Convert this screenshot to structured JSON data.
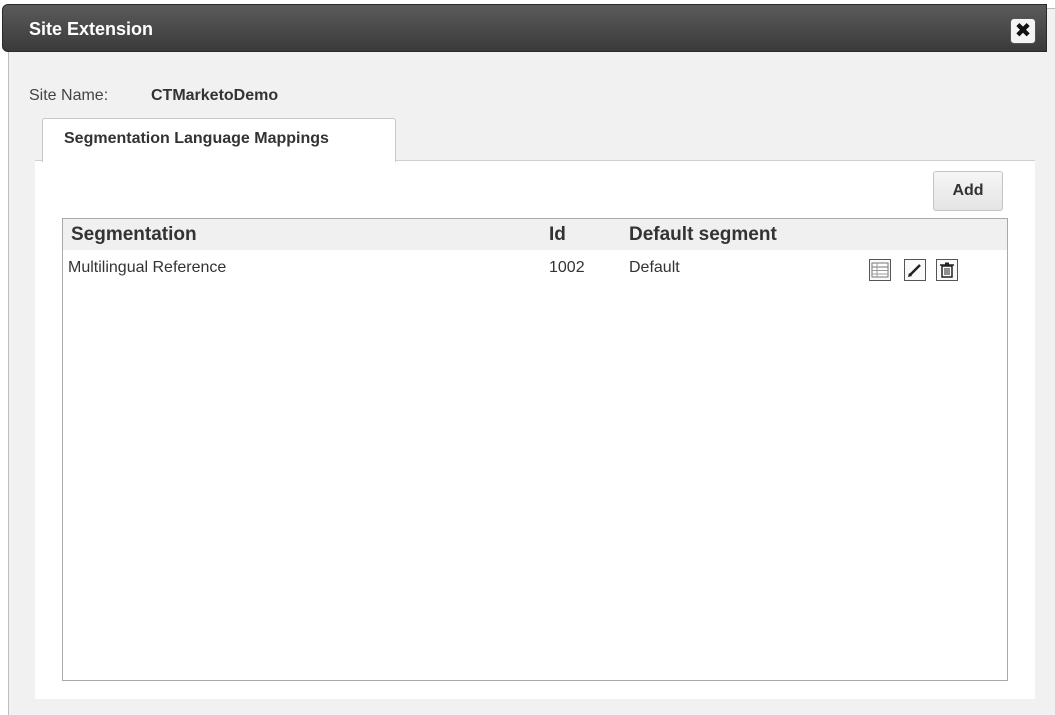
{
  "dialog": {
    "title": "Site Extension",
    "close_glyph": "✖"
  },
  "site": {
    "label": "Site Name:",
    "value": "CTMarketoDemo"
  },
  "tabs": [
    {
      "label": "Segmentation Language Mappings",
      "active": true
    }
  ],
  "toolbar": {
    "add_label": "Add"
  },
  "table": {
    "columns": [
      "Segmentation",
      "Id",
      "Default segment"
    ],
    "rows": [
      {
        "segmentation": "Multilingual Reference",
        "id": "1002",
        "default_segment": "Default",
        "actions": [
          "view-details-icon",
          "edit-icon",
          "delete-icon"
        ]
      }
    ]
  },
  "colors": {
    "titlebar": "#3f3f3f",
    "dialog_background": "#f1f1f1",
    "grid_header": "#f0f0f0"
  }
}
